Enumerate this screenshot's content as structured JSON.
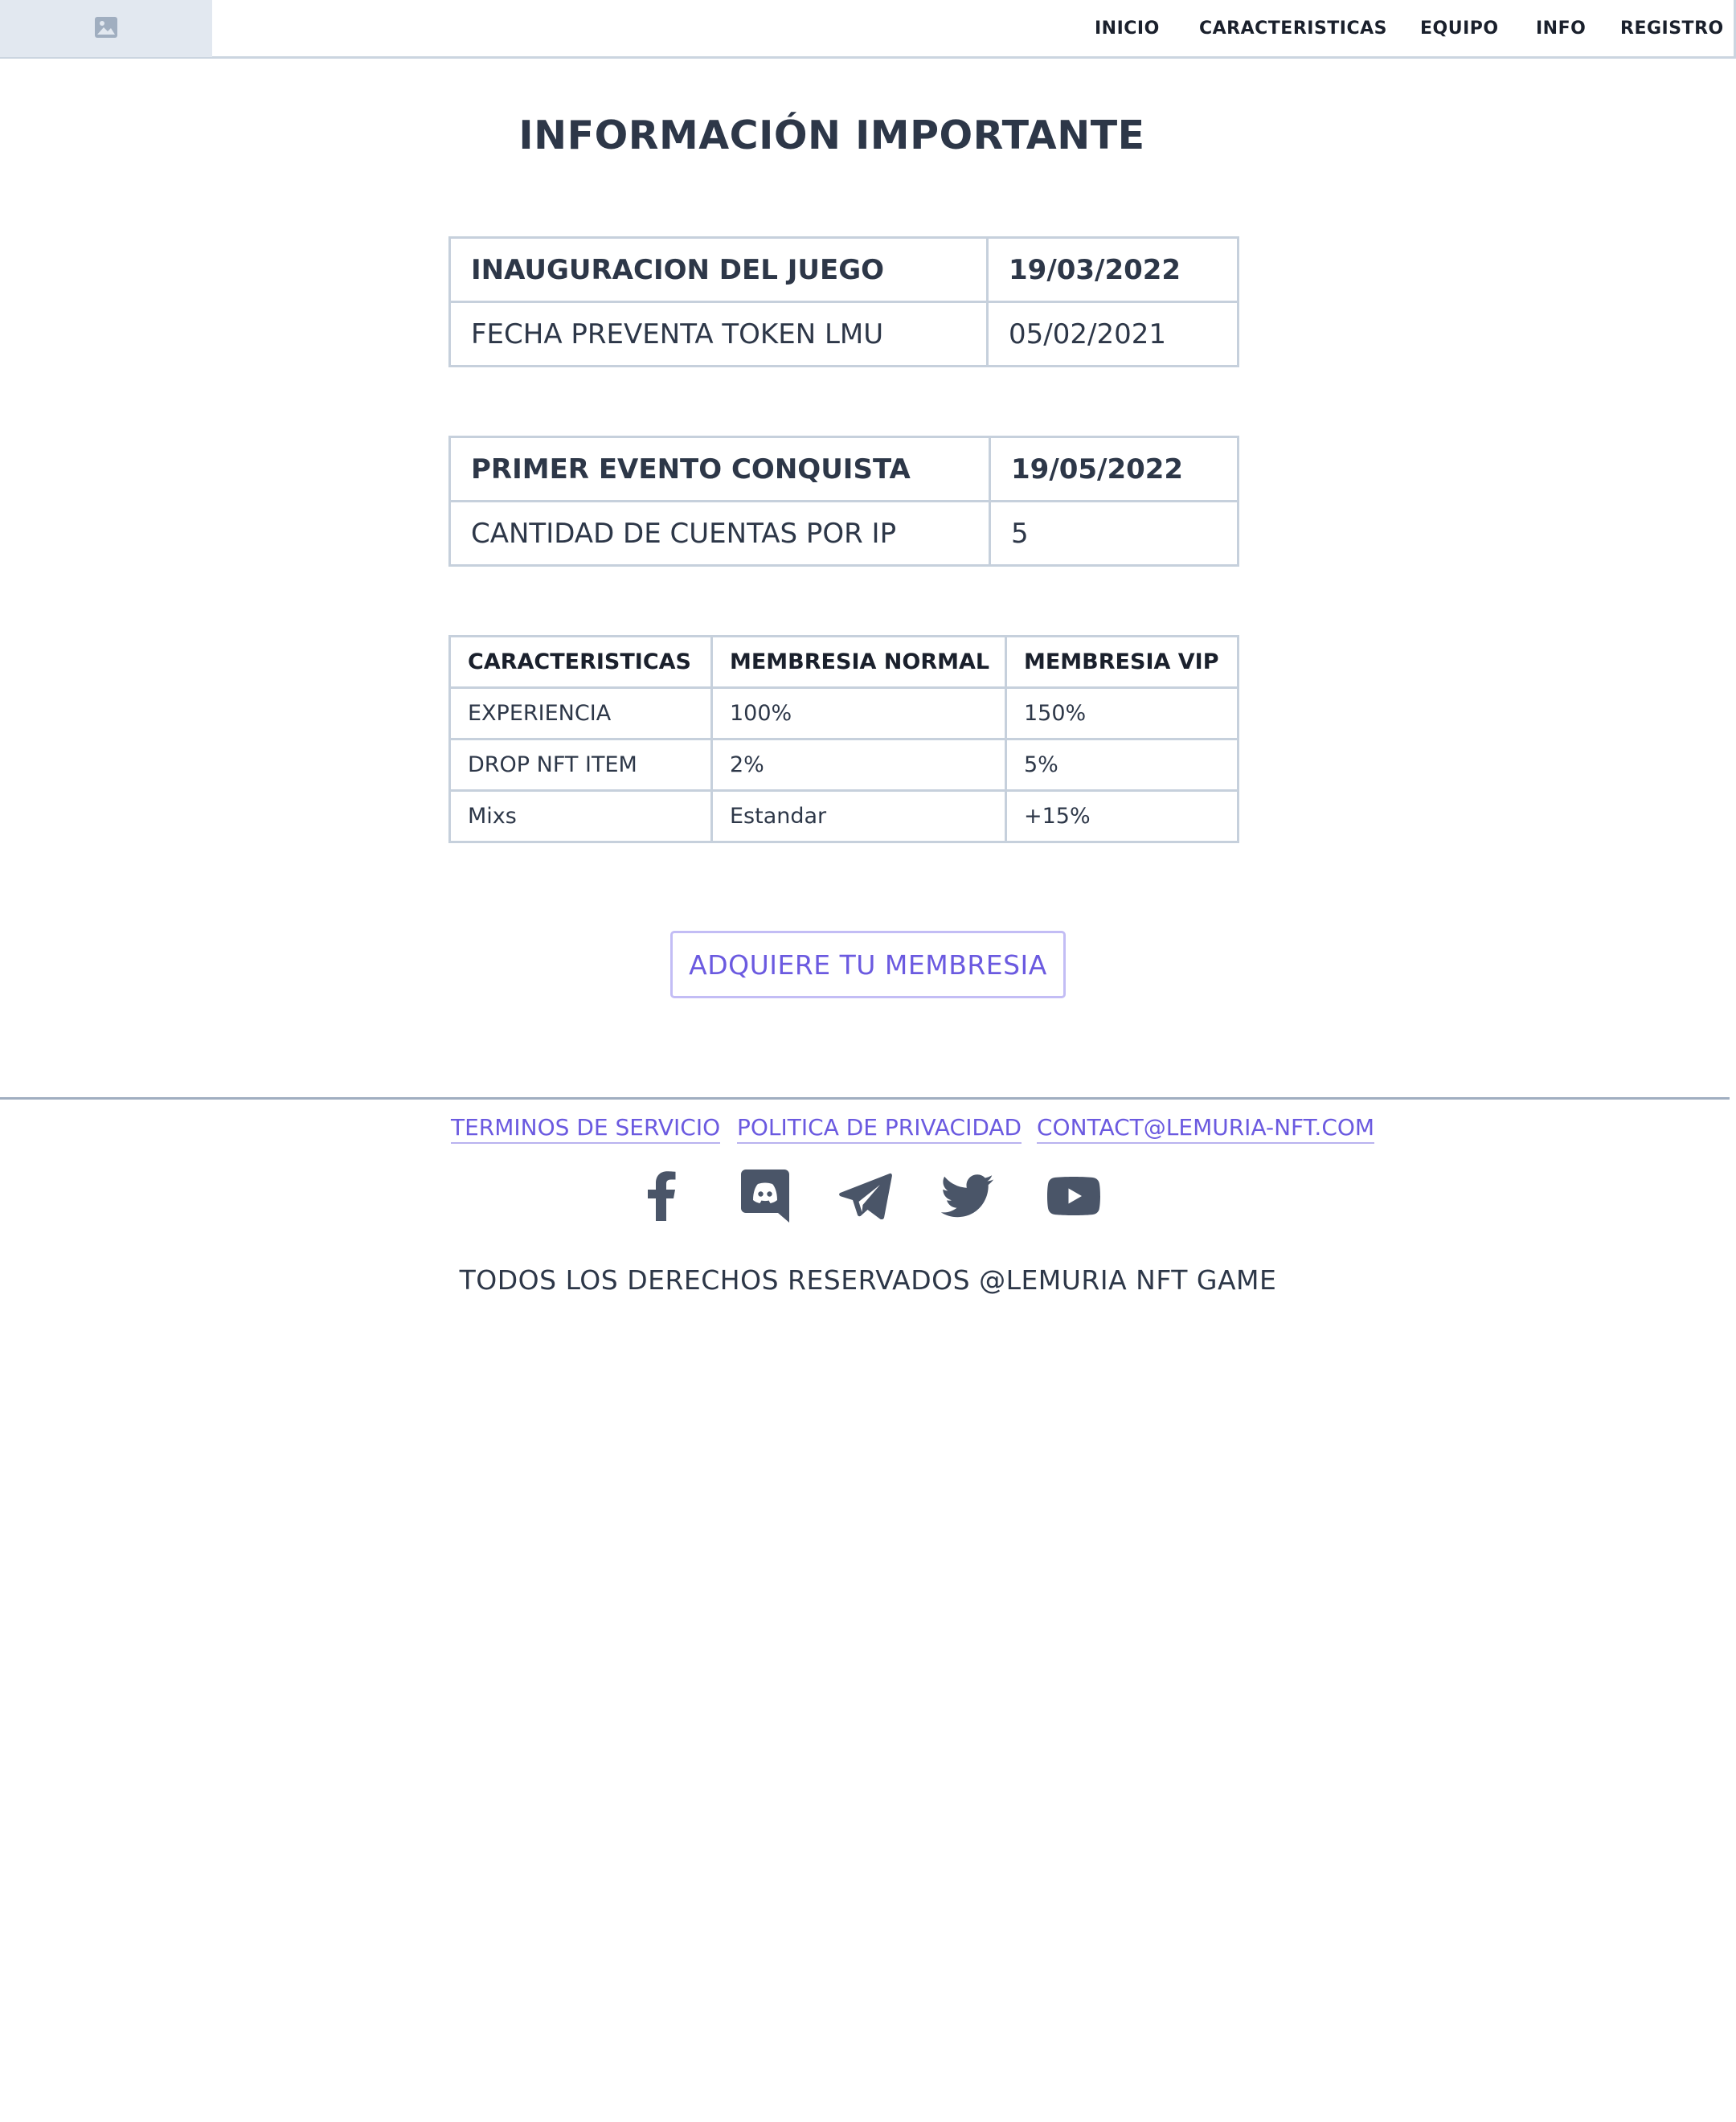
{
  "nav": {
    "items": [
      {
        "label": "INICIO"
      },
      {
        "label": "CARACTERISTICAS"
      },
      {
        "label": "EQUIPO"
      },
      {
        "label": "INFO"
      },
      {
        "label": "REGISTRO"
      }
    ],
    "logo_icon": "image-icon"
  },
  "title": "INFORMACIÓN IMPORTANTE",
  "table1": {
    "rows": [
      {
        "label": "INAUGURACION DEL JUEGO",
        "value": "19/03/2022"
      },
      {
        "label": "FECHA PREVENTA TOKEN LMU",
        "value": "05/02/2021"
      }
    ]
  },
  "table2": {
    "rows": [
      {
        "label": "PRIMER EVENTO CONQUISTA",
        "value": "19/05/2022"
      },
      {
        "label": "CANTIDAD DE CUENTAS POR IP",
        "value": "5"
      }
    ]
  },
  "membership_table": {
    "headers": [
      "CARACTERISTICAS",
      "MEMBRESIA NORMAL",
      "MEMBRESIA VIP"
    ],
    "rows": [
      [
        "EXPERIENCIA",
        "100%",
        "150%"
      ],
      [
        "DROP NFT ITEM",
        "2%",
        "5%"
      ],
      [
        "Mixs",
        "Estandar",
        "+15%"
      ]
    ]
  },
  "cta": {
    "label": "ADQUIERE TU MEMBRESIA"
  },
  "footer": {
    "links": [
      {
        "label": "TERMINOS DE SERVICIO"
      },
      {
        "label": "POLITICA DE PRIVACIDAD"
      },
      {
        "label": "CONTACT@LEMURIA-NFT.COM"
      }
    ],
    "social_icons": [
      "facebook-icon",
      "discord-icon",
      "telegram-icon",
      "twitter-icon",
      "youtube-icon"
    ],
    "copyright": "TODOS LOS DERECHOS RESERVADOS @LEMURIA NFT GAME"
  },
  "colors": {
    "text": "#2d3748",
    "accent": "#6b5ae0",
    "border": "#c6d0dc",
    "icon": "#4a5568"
  }
}
